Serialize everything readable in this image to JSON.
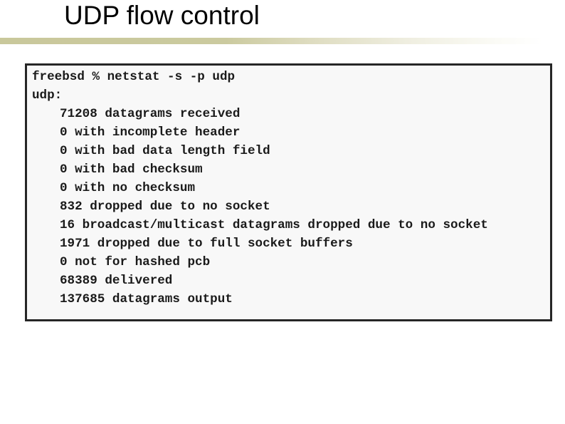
{
  "slide": {
    "title": "UDP flow control"
  },
  "terminal": {
    "lines": [
      {
        "text": "freebsd % netstat -s -p udp",
        "indent": false
      },
      {
        "text": "udp:",
        "indent": false
      },
      {
        "text": "71208 datagrams received",
        "indent": true
      },
      {
        "text": "0 with incomplete header",
        "indent": true
      },
      {
        "text": "0 with bad data length field",
        "indent": true
      },
      {
        "text": "0 with bad checksum",
        "indent": true
      },
      {
        "text": "0 with no checksum",
        "indent": true
      },
      {
        "text": "832 dropped due to no socket",
        "indent": true
      },
      {
        "text": "16 broadcast/multicast datagrams dropped due to no socket",
        "indent": true
      },
      {
        "text": "1971 dropped due to full socket buffers",
        "indent": true
      },
      {
        "text": "0 not for hashed pcb",
        "indent": true
      },
      {
        "text": "68389 delivered",
        "indent": true
      },
      {
        "text": "137685 datagrams output",
        "indent": true
      }
    ]
  },
  "colors": {
    "title_rule": "#c9c89b",
    "terminal_background": "#f8f8f8",
    "terminal_border": "#262626",
    "text": "#1a1a1a"
  }
}
